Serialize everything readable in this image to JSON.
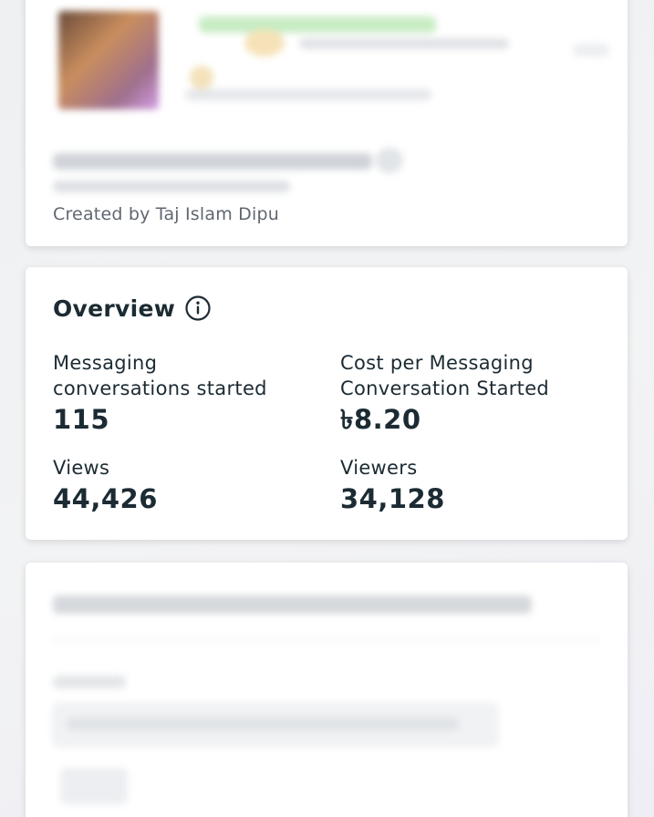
{
  "campaign": {
    "created_by": "Created by Taj Islam Dipu"
  },
  "overview": {
    "title": "Overview",
    "metrics": [
      {
        "label": "Messaging\nconversations started",
        "value": "115"
      },
      {
        "label": "Cost per Messaging\nConversation Started",
        "value": "৳8.20"
      },
      {
        "label": "Views",
        "value": "44,426"
      },
      {
        "label": "Viewers",
        "value": "34,128"
      }
    ]
  },
  "colors": {
    "text_primary": "#1c2b33",
    "text_secondary": "#606770",
    "card_background": "#ffffff",
    "page_background": "#eff0f2"
  },
  "icons": {
    "overview_info": "info-icon",
    "campaign_thumbnail": "ad-thumbnail-image"
  }
}
